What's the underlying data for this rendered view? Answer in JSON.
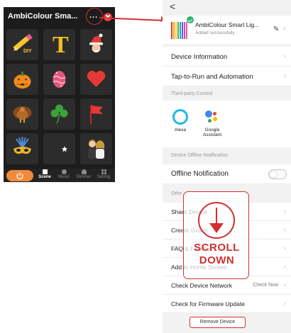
{
  "left": {
    "title": "AmbiColour Sma...",
    "more_icon": "...",
    "scenes": [
      {
        "name": "diy-pencil-icon",
        "label": "DIY"
      },
      {
        "name": "letter-t-icon",
        "label": "T"
      },
      {
        "name": "santa-icon",
        "label": ""
      },
      {
        "name": "pumpkin-icon",
        "label": ""
      },
      {
        "name": "easter-egg-icon",
        "label": ""
      },
      {
        "name": "heart-icon",
        "label": ""
      },
      {
        "name": "turkey-icon",
        "label": ""
      },
      {
        "name": "shamrock-icon",
        "label": ""
      },
      {
        "name": "flag-icon",
        "label": ""
      },
      {
        "name": "carnival-mask-icon",
        "label": ""
      },
      {
        "name": "crescent-star-icon",
        "label": ""
      },
      {
        "name": "couple-icon",
        "label": ""
      }
    ],
    "tabs": [
      {
        "label": "Scene",
        "icon": "scene-icon"
      },
      {
        "label": "Music",
        "icon": "music-icon"
      },
      {
        "label": "Dimmer",
        "icon": "bulb-icon"
      },
      {
        "label": "Setting",
        "icon": "grid-icon"
      }
    ]
  },
  "right": {
    "back": "<",
    "device": {
      "name": "AmbiColour Smart Lig...",
      "subtitle": "Added successfully"
    },
    "menu_top": [
      {
        "label": "Device Information"
      },
      {
        "label": "Tap-to-Run and Automation"
      }
    ],
    "third_party_header": "Third-party Control",
    "third_party": [
      {
        "label": "Alexa",
        "icon": "alexa-icon"
      },
      {
        "label": "Google\nAssistant",
        "icon": "google-assistant-icon"
      }
    ],
    "offline_header": "Device Offline Notification",
    "offline_label": "Offline Notification",
    "other_header": "Othe",
    "menu_other": [
      {
        "label": "Share Device"
      },
      {
        "label": "Create Group"
      },
      {
        "label": "FAQ & Feedback"
      },
      {
        "label": "Add to Home Screen"
      },
      {
        "label": "Check Device Network",
        "value": "Check Now"
      },
      {
        "label": "Check for Firmware Update"
      }
    ],
    "remove_label": "Remove Device"
  },
  "overlay": {
    "line1": "SCROLL",
    "line2": "DOWN"
  },
  "colors": {
    "accent_red": "#d32f2f",
    "power_orange": "#f08a3a",
    "dark_bg": "#1c1c1c"
  }
}
